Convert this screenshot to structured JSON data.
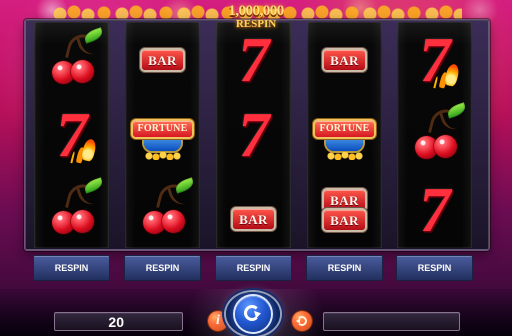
{
  "header": {
    "jackpot_amount": "1,000,000",
    "jackpot_label": "RESPIN"
  },
  "reels": [
    {
      "symbols": [
        "cherry",
        "seven",
        "cherry"
      ]
    },
    {
      "symbols": [
        "bar",
        "fortune",
        "cherry"
      ],
      "labels": [
        "BAR",
        "FORTUNE"
      ]
    },
    {
      "symbols": [
        "seven",
        "seven",
        "bar"
      ],
      "labels": [
        "",
        "",
        "BAR"
      ]
    },
    {
      "symbols": [
        "bar",
        "fortune",
        "double-bar"
      ],
      "labels": [
        "BAR",
        "FORTUNE",
        "BAR",
        "BAR"
      ]
    },
    {
      "symbols": [
        "seven",
        "cherry",
        "seven"
      ]
    }
  ],
  "respin_buttons": [
    {
      "label": "RESPIN"
    },
    {
      "label": "RESPIN"
    },
    {
      "label": "RESPIN"
    },
    {
      "label": "RESPIN"
    },
    {
      "label": "RESPIN"
    }
  ],
  "footer": {
    "bet_value": "20",
    "info_label": "i"
  },
  "colors": {
    "background_top": "#d51e80",
    "background_bottom": "#2a0930",
    "respin_button": "#2f427f",
    "spin_button": "#2157d1",
    "accent_orange": "#ff6d39"
  },
  "icons": {
    "spin": "spin-icon",
    "autoplay": "autoplay-icon",
    "info": "info-icon"
  }
}
